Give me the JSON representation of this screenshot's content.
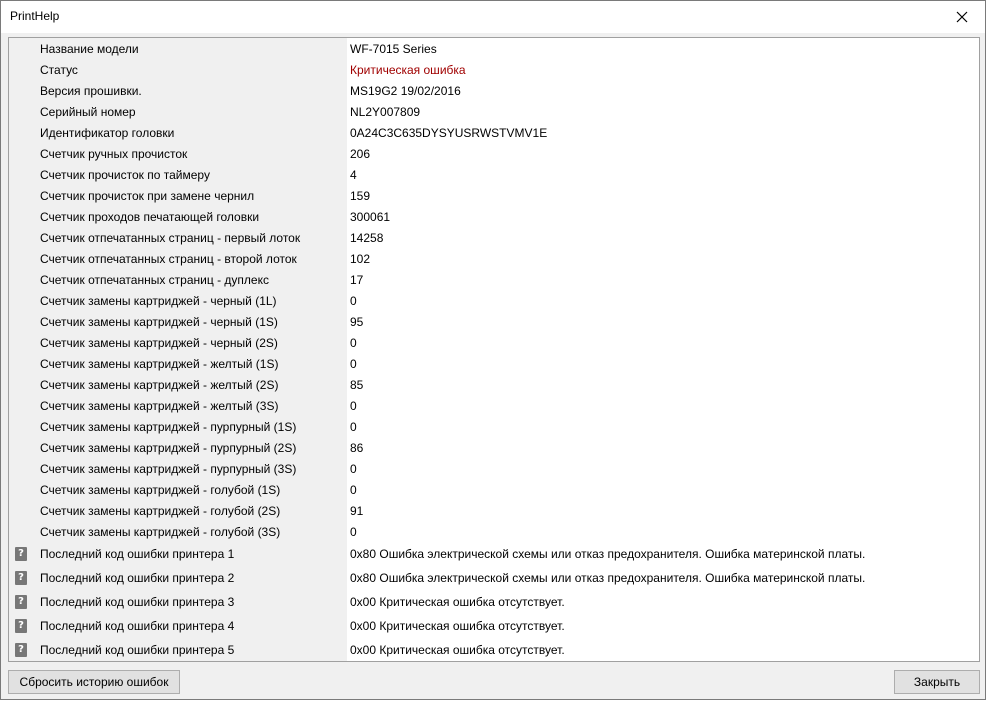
{
  "window": {
    "title": "PrintHelp"
  },
  "rows": [
    {
      "label": "Название модели",
      "value": "WF-7015 Series"
    },
    {
      "label": "Статус",
      "value": "Критическая ошибка",
      "critical": true
    },
    {
      "label": "Версия прошивки.",
      "value": "MS19G2 19/02/2016"
    },
    {
      "label": "Серийный номер",
      "value": "NL2Y007809"
    },
    {
      "label": "Идентификатор головки",
      "value": "0A24C3C635DYSYUSRWSTVMV1E"
    },
    {
      "label": "Счетчик ручных прочисток",
      "value": "206"
    },
    {
      "label": "Счетчик прочисток по таймеру",
      "value": "4"
    },
    {
      "label": "Счетчик прочисток при замене чернил",
      "value": "159"
    },
    {
      "label": "Счетчик проходов печатающей головки",
      "value": "300061"
    },
    {
      "label": "Счетчик отпечатанных страниц - первый лоток",
      "value": "14258"
    },
    {
      "label": "Счетчик отпечатанных страниц - второй лоток",
      "value": "102"
    },
    {
      "label": "Счетчик отпечатанных страниц - дуплекс",
      "value": "17"
    },
    {
      "label": "Счетчик замены картриджей - черный (1L)",
      "value": "0"
    },
    {
      "label": "Счетчик замены картриджей - черный (1S)",
      "value": "95"
    },
    {
      "label": "Счетчик замены картриджей - черный (2S)",
      "value": "0"
    },
    {
      "label": "Счетчик замены картриджей - желтый (1S)",
      "value": "0"
    },
    {
      "label": "Счетчик замены картриджей - желтый (2S)",
      "value": "85"
    },
    {
      "label": "Счетчик замены картриджей - желтый (3S)",
      "value": "0"
    },
    {
      "label": "Счетчик замены картриджей - пурпурный (1S)",
      "value": "0"
    },
    {
      "label": "Счетчик замены картриджей - пурпурный (2S)",
      "value": "86"
    },
    {
      "label": "Счетчик замены картриджей - пурпурный (3S)",
      "value": "0"
    },
    {
      "label": "Счетчик замены картриджей - голубой (1S)",
      "value": "0"
    },
    {
      "label": "Счетчик замены картриджей - голубой (2S)",
      "value": "91"
    },
    {
      "label": "Счетчик замены картриджей - голубой (3S)",
      "value": "0"
    }
  ],
  "error_rows": [
    {
      "label": "Последний код ошибки принтера 1",
      "value": "0x80 Ошибка электрической схемы или отказ предохранителя. Ошибка материнской платы.",
      "icon": "help-icon"
    },
    {
      "label": "Последний код ошибки принтера 2",
      "value": "0x80 Ошибка электрической схемы или отказ предохранителя. Ошибка материнской платы.",
      "icon": "help-icon"
    },
    {
      "label": "Последний код ошибки принтера 3",
      "value": "0x00 Критическая ошибка отсутствует.",
      "icon": "help-icon"
    },
    {
      "label": "Последний код ошибки принтера 4",
      "value": "0x00 Критическая ошибка отсутствует.",
      "icon": "help-icon"
    },
    {
      "label": "Последний код ошибки принтера 5",
      "value": "0x00 Критическая ошибка отсутствует.",
      "icon": "help-icon"
    }
  ],
  "buttons": {
    "reset_label": "Сбросить историю ошибок",
    "close_label": "Закрыть"
  },
  "colors": {
    "critical": "#a00000",
    "window_bg": "#f0f0f0",
    "value_bg": "#ffffff",
    "icon_bg": "#777777"
  }
}
